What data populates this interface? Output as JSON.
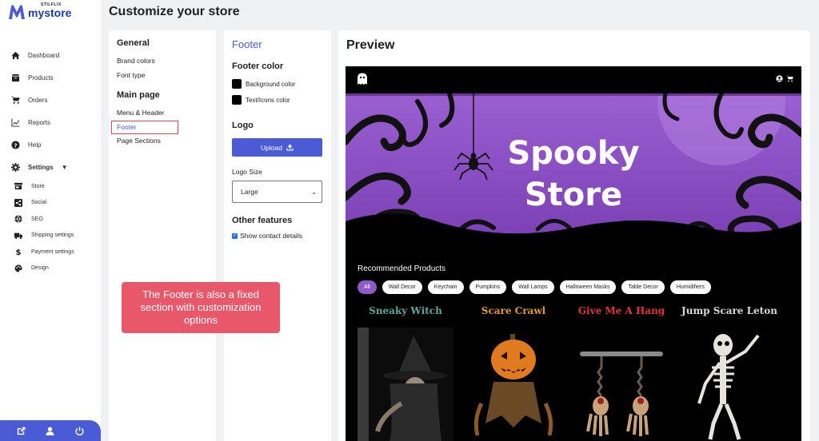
{
  "brand": {
    "sub": "STILFLIX",
    "name": "mystore",
    "accent": "#4b5bd6"
  },
  "page_title": "Customize your store",
  "sidebar": {
    "items": [
      {
        "label": "Dashboard",
        "icon": "home-icon"
      },
      {
        "label": "Products",
        "icon": "box-icon"
      },
      {
        "label": "Orders",
        "icon": "cart-icon"
      },
      {
        "label": "Reports",
        "icon": "chart-icon"
      },
      {
        "label": "Help",
        "icon": "help-icon"
      },
      {
        "label": "Settings",
        "icon": "gear-icon"
      }
    ],
    "sub_items": [
      {
        "label": "Store",
        "icon": "store-icon"
      },
      {
        "label": "Social",
        "icon": "share-icon"
      },
      {
        "label": "SEO",
        "icon": "globe-icon"
      },
      {
        "label": "Shipping settings",
        "icon": "truck-icon"
      },
      {
        "label": "Payment settings",
        "icon": "dollar-icon"
      },
      {
        "label": "Design",
        "icon": "palette-icon"
      }
    ],
    "bottom_icons": [
      "external-link-icon",
      "user-icon",
      "power-icon"
    ]
  },
  "panel1": {
    "general_heading": "General",
    "general_links": [
      "Brand colors",
      "Font type"
    ],
    "main_heading": "Main page",
    "main_links": [
      "Menu & Header",
      "Footer",
      "Page Sections"
    ],
    "active": "Footer"
  },
  "panel2": {
    "title": "Footer",
    "color_heading": "Footer color",
    "bg_color_label": "Background color",
    "text_color_label": "Text/Icons color",
    "logo_heading": "Logo",
    "upload_label": "Upload",
    "logo_size_label": "Logo Size",
    "logo_size_value": "Large",
    "other_heading": "Other features",
    "show_contact_label": "Show contact details",
    "show_contact_checked": true
  },
  "callout": "The Footer is also a fixed section with customization options",
  "preview": {
    "title": "Preview",
    "hero_line1": "Spooky",
    "hero_line2": "Store",
    "recommended_title": "Recommended Products",
    "filters": [
      "All",
      "Wall Decor",
      "Keychain",
      "Pumpkins",
      "Wall Lamps",
      "Halloween Masks",
      "Table Decor",
      "Humidifiers"
    ],
    "active_filter": "All",
    "products": [
      {
        "name": "Sneaky Witch",
        "color": "#5ea69a"
      },
      {
        "name": "Scare Crawl",
        "color": "#e09a2a"
      },
      {
        "name": "Give Me A Hang",
        "color": "#e0343a"
      },
      {
        "name": "Jump Scare Leton",
        "color": "#d8d8d8"
      }
    ]
  }
}
